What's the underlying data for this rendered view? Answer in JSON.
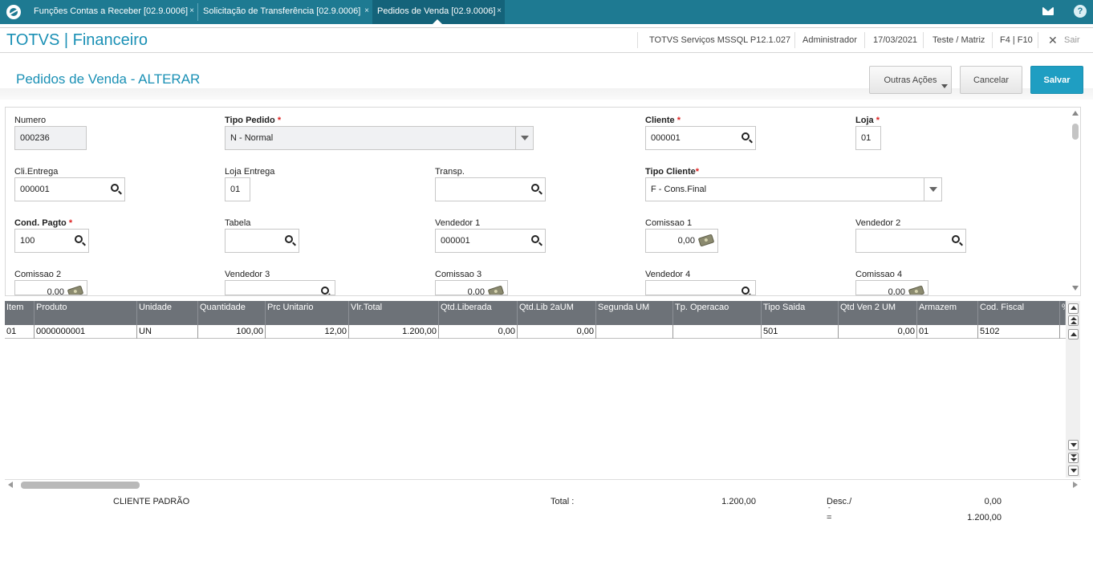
{
  "tabs": [
    {
      "label": "Funções Contas a Receber [02.9.0006]"
    },
    {
      "label": "Solicitação de Transferência [02.9.0006]"
    },
    {
      "label": "Pedidos de Venda [02.9.0006]"
    }
  ],
  "tab_close": "×",
  "help": "?",
  "header": {
    "app_title": "TOTVS | Financeiro",
    "environment": "TOTVS Serviços MSSQL P12.1.027",
    "user": "Administrador",
    "date": "17/03/2021",
    "branch": "Teste / Matriz",
    "shortcuts": "F4 | F10",
    "exit": "Sair"
  },
  "page": {
    "title": "Pedidos de Venda - ALTERAR",
    "other_actions": "Outras Ações",
    "cancel": "Cancelar",
    "save": "Salvar"
  },
  "form": {
    "numero": {
      "label": "Numero",
      "value": "000236"
    },
    "tipo_pedido": {
      "label": "Tipo Pedido",
      "value": "N - Normal"
    },
    "cliente": {
      "label": "Cliente",
      "value": "000001"
    },
    "loja": {
      "label": "Loja",
      "value": "01"
    },
    "cli_entrega": {
      "label": "Cli.Entrega",
      "value": "000001"
    },
    "loja_entrega": {
      "label": "Loja Entrega",
      "value": "01"
    },
    "transp": {
      "label": "Transp.",
      "value": ""
    },
    "tipo_cliente": {
      "label": "Tipo Cliente",
      "value": "F - Cons.Final"
    },
    "cond_pagto": {
      "label": "Cond. Pagto",
      "value": "100"
    },
    "tabela": {
      "label": "Tabela",
      "value": ""
    },
    "vendedor1": {
      "label": "Vendedor 1",
      "value": "000001"
    },
    "comissao1": {
      "label": "Comissao 1",
      "value": "0,00"
    },
    "vendedor2": {
      "label": "Vendedor 2",
      "value": ""
    },
    "comissao2": {
      "label": "Comissao 2",
      "value": "0,00"
    },
    "vendedor3": {
      "label": "Vendedor 3",
      "value": ""
    },
    "comissao3": {
      "label": "Comissao 3",
      "value": "0,00"
    },
    "vendedor4": {
      "label": "Vendedor 4",
      "value": ""
    },
    "comissao4": {
      "label": "Comissao 4",
      "value": "0,00"
    },
    "required_mark": "*"
  },
  "grid": {
    "columns": [
      "Item",
      "Produto",
      "Unidade",
      "Quantidade",
      "Prc Unitario",
      "Vlr.Total",
      "Qtd.Liberada",
      "Qtd.Lib 2aUM",
      "Segunda UM",
      "Tp. Operacao",
      "Tipo Saida",
      "Qtd Ven 2 UM",
      "Armazem",
      "Cod. Fiscal",
      "%"
    ],
    "rows": [
      [
        "01",
        "0000000001",
        "UN",
        "100,00",
        "12,00",
        "1.200,00",
        "0,00",
        "0,00",
        "",
        "",
        "501",
        "0,00",
        "01",
        "5102"
      ]
    ]
  },
  "footer": {
    "client_name": "CLIENTE PADRÃO",
    "total_label": "Total :",
    "total_value": "1.200,00",
    "desc_label": "Desc./",
    "desc_value": "0,00",
    "desc_sep": "-",
    "eq_label": "=",
    "net_value": "1.200,00"
  }
}
